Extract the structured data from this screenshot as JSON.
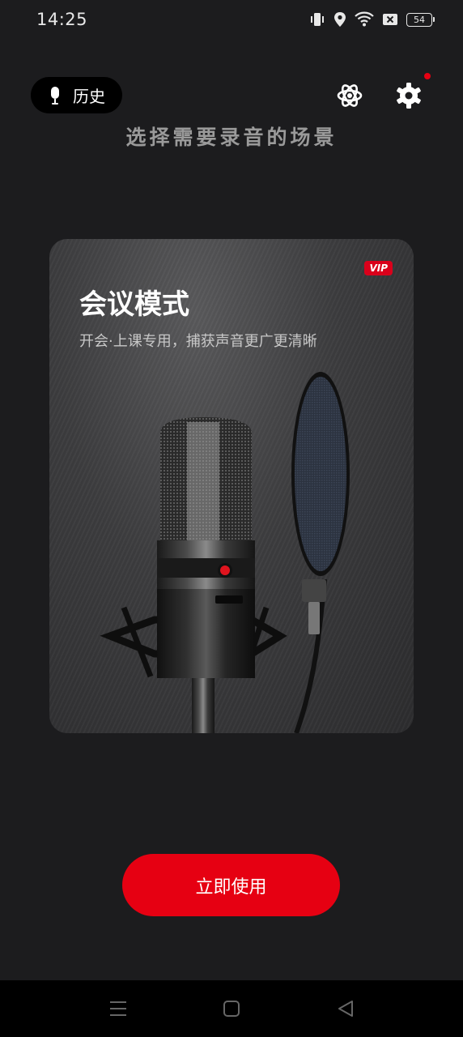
{
  "status_bar": {
    "time": "14:25",
    "battery": "54",
    "icons": [
      "vibrate-icon",
      "location-icon",
      "wifi-icon",
      "sim-x-icon",
      "battery-icon"
    ]
  },
  "header": {
    "history_label": "历史",
    "title": "选择需要录音的场景"
  },
  "card": {
    "badge": "VIP",
    "title": "会议模式",
    "description": "开会·上课专用，捕获声音更广更清晰"
  },
  "action": {
    "use_label": "立即使用"
  },
  "colors": {
    "accent": "#e60012",
    "background": "#1c1c1e"
  },
  "nav": {
    "icons": [
      "menu-icon",
      "home-icon",
      "back-icon"
    ]
  }
}
